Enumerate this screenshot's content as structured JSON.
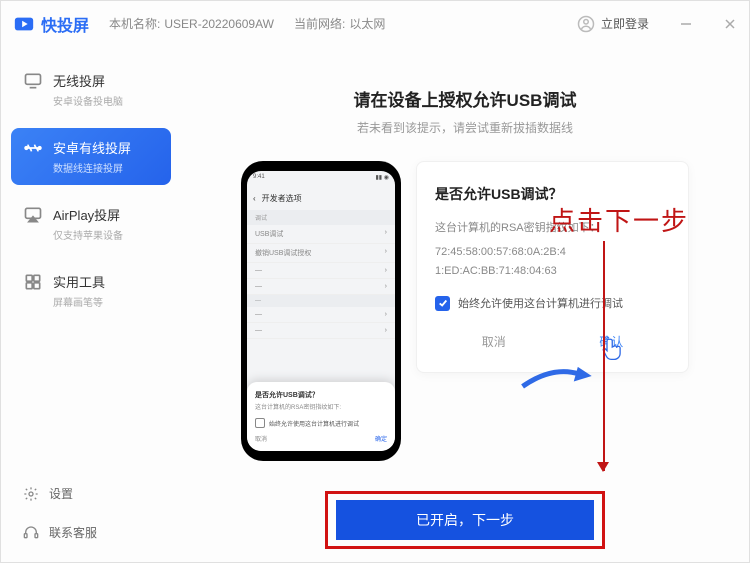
{
  "titlebar": {
    "app_name": "快投屏",
    "host_label": "本机名称:",
    "host_value": "USER-20220609AW",
    "net_label": "当前网络:",
    "net_value": "以太网",
    "login_text": "立即登录"
  },
  "sidebar": {
    "items": [
      {
        "title": "无线投屏",
        "sub": "安卓设备投电脑",
        "icon": "cast-icon"
      },
      {
        "title": "安卓有线投屏",
        "sub": "数据线连接投屏",
        "icon": "usb-icon"
      },
      {
        "title": "AirPlay投屏",
        "sub": "仅支持苹果设备",
        "icon": "airplay-icon"
      },
      {
        "title": "实用工具",
        "sub": "屏幕画笔等",
        "icon": "tools-icon"
      }
    ],
    "settings_label": "设置",
    "support_label": "联系客服"
  },
  "main": {
    "heading": "请在设备上授权允许USB调试",
    "sub": "若未看到该提示，请尝试重新拔插数据线",
    "phone": {
      "status_left": "9:41",
      "dev_header": "开发者选项",
      "row1": "USB调试",
      "row2": "撤销USB调试授权",
      "sec": "调试",
      "popup_title": "是否允许USB调试？",
      "popup_body": "这台计算机的RSA密钥指纹如下:",
      "popup_check": "始终允许使用这台计算机进行调试",
      "popup_cancel": "取消",
      "popup_ok": "确定"
    },
    "card": {
      "title": "是否允许USB调试？",
      "subtitle": "这台计算机的RSA密钥指纹如下：",
      "fp1": "72:45:58:00:57:68:0A:2B:4",
      "fp2": "1:ED:AC:BB:71:48:04:63",
      "check_label": "始终允许使用这台计算机进行调试",
      "cancel": "取消",
      "ok": "确认"
    },
    "cta_label": "已开启，下一步",
    "annotation": "点击下一步"
  }
}
